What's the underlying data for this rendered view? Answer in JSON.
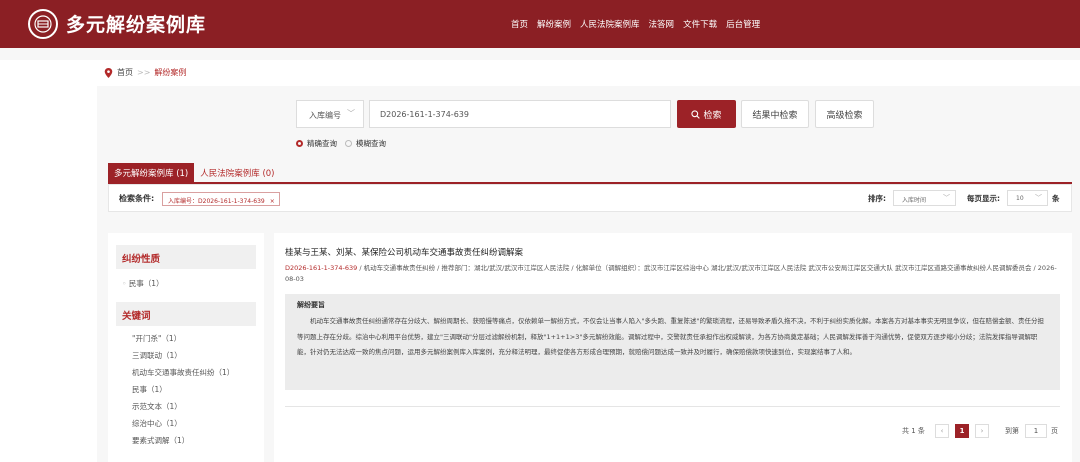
{
  "header": {
    "title": "多元解纷案例库",
    "nav": [
      "首页",
      "解纷案例",
      "人民法院案例库",
      "法答网",
      "文件下载",
      "后台管理"
    ]
  },
  "breadcrumb": {
    "home": "首页",
    "separator": ">>",
    "current": "解纷案例"
  },
  "search": {
    "field_type": "入库编号",
    "query": "D2026-161-1-374-639",
    "search_button": "检索",
    "within_results_button": "结果中检索",
    "advanced_button": "高级检索",
    "mode_exact": "精确查询",
    "mode_fuzzy": "模糊查询"
  },
  "tabs": [
    {
      "label": "多元解纷案例库 (1)",
      "active": true
    },
    {
      "label": "人民法院案例库 (0)",
      "active": false
    }
  ],
  "conditions": {
    "label": "检索条件:",
    "tag": "入库编号：D2026-161-1-374-639",
    "tag_close": "×",
    "sort_label": "排序:",
    "sort_value": "入库时间",
    "page_size_label": "每页显示:",
    "page_size_value": "10",
    "page_size_unit": "条"
  },
  "facets": {
    "nature_title": "纠纷性质",
    "nature_items": [
      "民事（1）"
    ],
    "keyword_title": "关键词",
    "keyword_items": [
      "\"开门杀\"（1）",
      "三调联动（1）",
      "机动车交通事故责任纠纷（1）",
      "民事（1）",
      "示范文本（1）",
      "综治中心（1）",
      "要素式调解（1）"
    ]
  },
  "result": {
    "title": "桂某与王某、刘某、某保险公司机动车交通事故责任纠纷调解案",
    "code": "D2026-161-1-374-639",
    "meta_rest": " / 机动车交通事故责任纠纷 / 推荐部门：湖北/武汉/武汉市江岸区人民法院 / 化解单位（调解组织）：武汉市江岸区综治中心 湖北/武汉/武汉市江岸区人民法院 武汉市公安局江岸区交通大队 武汉市江岸区道路交通事故纠纷人民调解委员会 / 2026-08-03",
    "summary_title": "解纷要旨",
    "summary_text": "机动车交通事故责任纠纷通常存在分歧大、解纷周期长、获赔慢等痛点，仅依赖单一解纷方式，不仅会让当事人陷入\"多头跑、重复陈述\"的繁琐流程，还易导致矛盾久拖不决，不利于纠纷实质化解。本案各方对基本事实无明显争议，但在赔偿金额、责任分担等问题上存在分歧。综治中心利用平台优势，建立\"三调联动\"分层过滤解纷机制，释放\"1+1+1>3\"多元解纷效能。调解过程中，交警就责任承担作出权威解读，为各方协商奠定基础；人民调解发挥善于沟通优势，促使双方逐步缩小分歧；法院发挥指导调解职能，针对仍无法达成一致的焦点问题，运用多元解纷案例库入库案例，充分释法明理，最终促使各方形成合理预期，就赔偿问题达成一致并及时履行，确保赔偿款项快速到位，实现案结事了人和。"
  },
  "pagination": {
    "total": "共 1 条",
    "current_page": "1",
    "goto_label": "到第",
    "goto_value": "1",
    "goto_unit": "页"
  }
}
